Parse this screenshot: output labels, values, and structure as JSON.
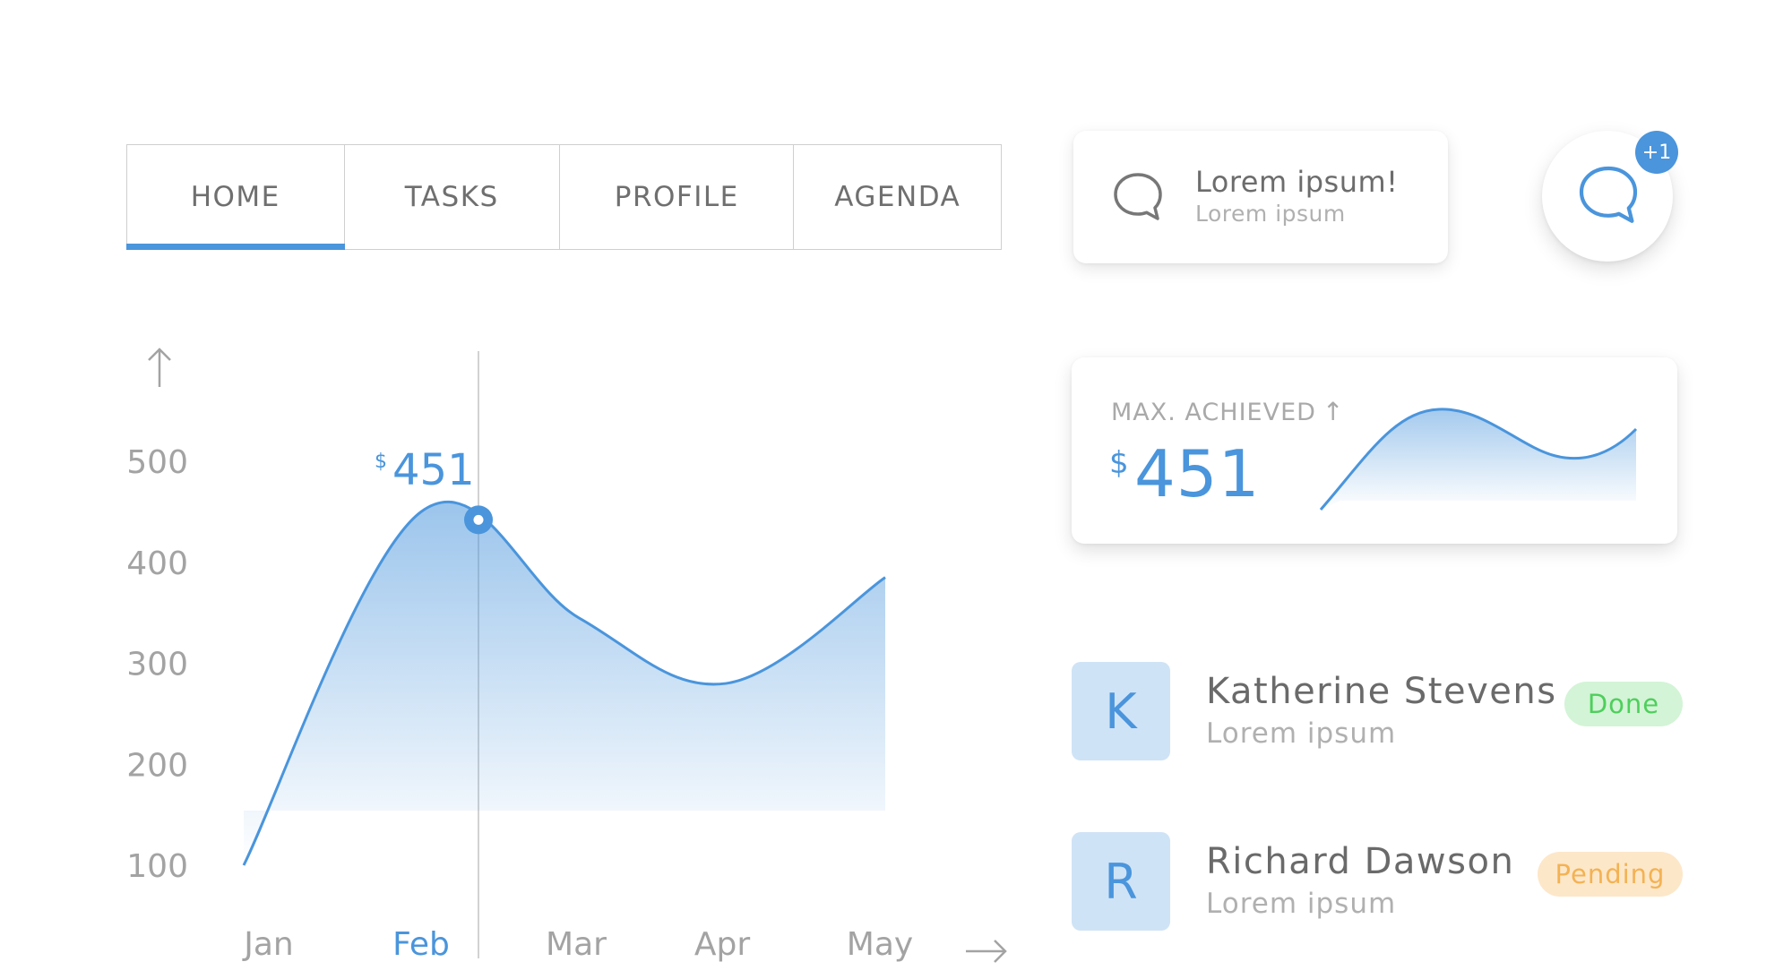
{
  "tabs": [
    {
      "label": "HOME",
      "active": true
    },
    {
      "label": "TASKS",
      "active": false
    },
    {
      "label": "PROFILE",
      "active": false
    },
    {
      "label": "AGENDA",
      "active": false
    }
  ],
  "chart_data": {
    "type": "area",
    "x": [
      "Jan",
      "Feb",
      "Mar",
      "Apr",
      "May"
    ],
    "values": [
      100,
      450,
      345,
      280,
      385
    ],
    "ylim": [
      50,
      600
    ],
    "yticks": [
      100,
      200,
      300,
      400,
      500
    ],
    "highlight": {
      "category": "Feb",
      "currency": "$",
      "value": "451"
    },
    "color": "#4a95dc"
  },
  "message_card": {
    "icon": "chat-bubble-icon",
    "title": "Lorem ipsum!",
    "subtitle": "Lorem ipsum"
  },
  "fab": {
    "icon": "chat-bubble-icon",
    "badge": "+1"
  },
  "max_card": {
    "label": "MAX. ACHIEVED",
    "arrow": "↑",
    "currency": "$",
    "value": "451"
  },
  "people": [
    {
      "initial": "K",
      "name": "Katherine Stevens",
      "subtitle": "Lorem ipsum",
      "status": "Done"
    },
    {
      "initial": "R",
      "name": "Richard Dawson",
      "subtitle": "Lorem ipsum",
      "status": "Pending"
    }
  ],
  "colors": {
    "accent": "#4a95dc",
    "done": "#4ecf5c",
    "pending": "#f3b253"
  }
}
